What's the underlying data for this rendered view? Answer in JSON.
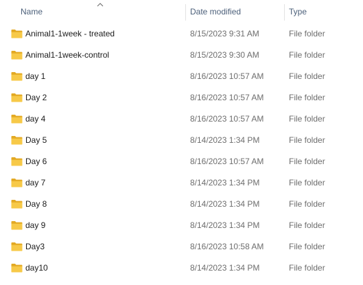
{
  "columns": {
    "name": "Name",
    "date_modified": "Date modified",
    "type": "Type",
    "sort_indicator": "chevron-up-icon"
  },
  "colors": {
    "folder_yellow": "#f7c948",
    "folder_dark": "#e3a923",
    "header_text": "#4c607a",
    "muted_text": "#6d6d6d"
  },
  "folder_icon": "folder-icon",
  "rows": [
    {
      "name": "Animal1-1week - treated",
      "date": "8/15/2023 9:31 AM",
      "type": "File folder"
    },
    {
      "name": "Animal1-1week-control",
      "date": "8/15/2023 9:30 AM",
      "type": "File folder"
    },
    {
      "name": "day 1",
      "date": "8/16/2023 10:57 AM",
      "type": "File folder"
    },
    {
      "name": "Day 2",
      "date": "8/16/2023 10:57 AM",
      "type": "File folder"
    },
    {
      "name": "day 4",
      "date": "8/16/2023 10:57 AM",
      "type": "File folder"
    },
    {
      "name": "Day 5",
      "date": "8/14/2023 1:34 PM",
      "type": "File folder"
    },
    {
      "name": "Day 6",
      "date": "8/16/2023 10:57 AM",
      "type": "File folder"
    },
    {
      "name": "day 7",
      "date": "8/14/2023 1:34 PM",
      "type": "File folder"
    },
    {
      "name": "Day 8",
      "date": "8/14/2023 1:34 PM",
      "type": "File folder"
    },
    {
      "name": "day 9",
      "date": "8/14/2023 1:34 PM",
      "type": "File folder"
    },
    {
      "name": "Day3",
      "date": "8/16/2023 10:58 AM",
      "type": "File folder"
    },
    {
      "name": "day10",
      "date": "8/14/2023 1:34 PM",
      "type": "File folder"
    }
  ]
}
